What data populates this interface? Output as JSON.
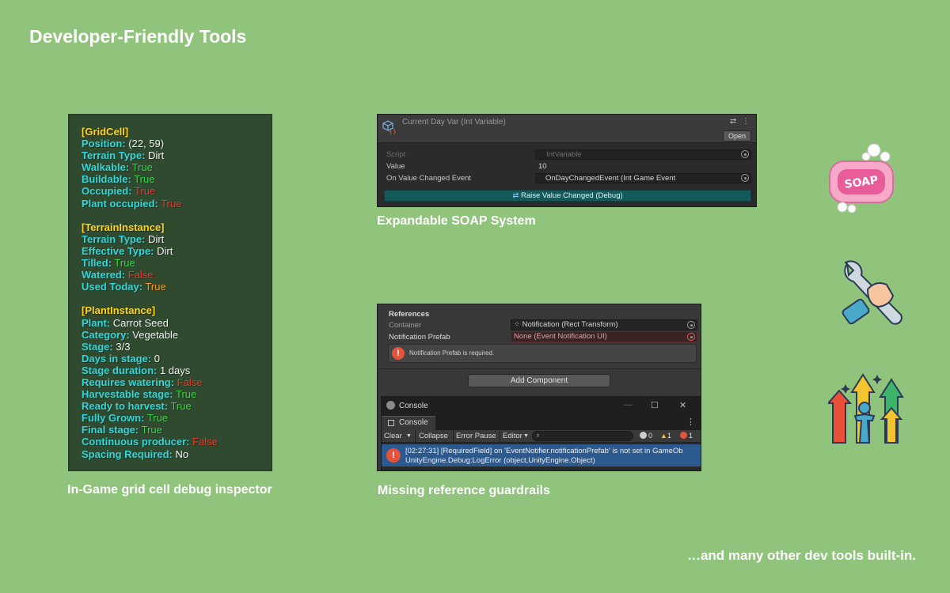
{
  "page": {
    "title": "Developer-Friendly Tools",
    "footer": "…and many other dev tools built-in."
  },
  "captions": {
    "debug": "In-Game grid cell debug inspector",
    "soap": "Expandable SOAP System",
    "guardrails": "Missing reference guardrails"
  },
  "debug_panel": {
    "grid_header": "[GridCell]",
    "grid": [
      {
        "key": "Position:",
        "value": " (22, 59)",
        "tone": "v"
      },
      {
        "key": "Terrain Type:",
        "value": " Dirt",
        "tone": "v"
      },
      {
        "key": "Walkable:",
        "value": " True",
        "tone": "t"
      },
      {
        "key": "Buildable:",
        "value": " True",
        "tone": "t"
      },
      {
        "key": "Occupied:",
        "value": " True",
        "tone": "f"
      },
      {
        "key": "Plant occupied:",
        "value": " True",
        "tone": "f"
      }
    ],
    "terrain_header": "[TerrainInstance]",
    "terrain": [
      {
        "key": "Terrain Type:",
        "value": " Dirt",
        "tone": "v"
      },
      {
        "key": "Effective Type:",
        "value": " Dirt",
        "tone": "v"
      },
      {
        "key": "Tilled:",
        "value": " True",
        "tone": "t"
      },
      {
        "key": "Watered:",
        "value": " False",
        "tone": "f"
      },
      {
        "key": "Used Today:",
        "value": " True",
        "tone": "o"
      }
    ],
    "plant_header": "[PlantInstance]",
    "plant": [
      {
        "key": "Plant:",
        "value": " Carrot Seed",
        "tone": "v"
      },
      {
        "key": "Category:",
        "value": " Vegetable",
        "tone": "v"
      },
      {
        "key": "Stage:",
        "value": " 3/3",
        "tone": "v"
      },
      {
        "key": "Days in stage:",
        "value": " 0",
        "tone": "v"
      },
      {
        "key": "Stage duration:",
        "value": " 1 days",
        "tone": "v"
      },
      {
        "key": "Requires watering:",
        "value": " False",
        "tone": "f"
      },
      {
        "key": "Harvestable stage:",
        "value": " True",
        "tone": "t"
      },
      {
        "key": "Ready to harvest:",
        "value": " True",
        "tone": "t"
      },
      {
        "key": "Fully Grown:",
        "value": " True",
        "tone": "t"
      },
      {
        "key": "Final stage:",
        "value": " True",
        "tone": "t"
      },
      {
        "key": "Continuous producer:",
        "value": " False",
        "tone": "f"
      },
      {
        "key": "Spacing Required:",
        "value": " No",
        "tone": "v"
      }
    ]
  },
  "inspector": {
    "title": "Current Day Var (Int Variable)",
    "tools": "⇄ ⋮",
    "open_label": "Open",
    "script_label": "Script",
    "script_value": "IntVariable",
    "value_label": "Value",
    "value_value": "10",
    "event_label": "On Value Changed Event",
    "event_value": "OnDayChangedEvent (Int Game Event",
    "raise_label": "Raise Value Changed (Debug)"
  },
  "references": {
    "title": "References",
    "container_label": "Container",
    "container_value": "Notification (Rect Transform)",
    "prefab_label": "Notification Prefab",
    "prefab_value": "None (Event Notification UI)",
    "help_message": "Notification Prefab is required.",
    "add_component": "Add Component"
  },
  "console": {
    "window_title": "Console",
    "tab_label": "Console",
    "clear": "Clear",
    "collapse": "Collapse",
    "error_pause": "Error Pause",
    "editor": "Editor",
    "count_info": "0",
    "count_warn": "1",
    "count_error": "1",
    "log_line1": "[02:27:31] [RequiredField] on 'EventNotifier.notificationPrefab' is not set in GameOb",
    "log_line2": "UnityEngine.Debug:LogError (object,UnityEngine.Object)"
  },
  "icons": [
    "soap-icon",
    "wrench-hand-icon",
    "growth-arrows-icon"
  ],
  "colors": {
    "background": "#90c47c",
    "debug_key": "#33d6d9",
    "debug_header": "#ffd21f",
    "true_green": "#39d64b",
    "false_red": "#ea3a2c",
    "raise_button": "#145a5a",
    "log_selected": "#2d5a8e"
  }
}
